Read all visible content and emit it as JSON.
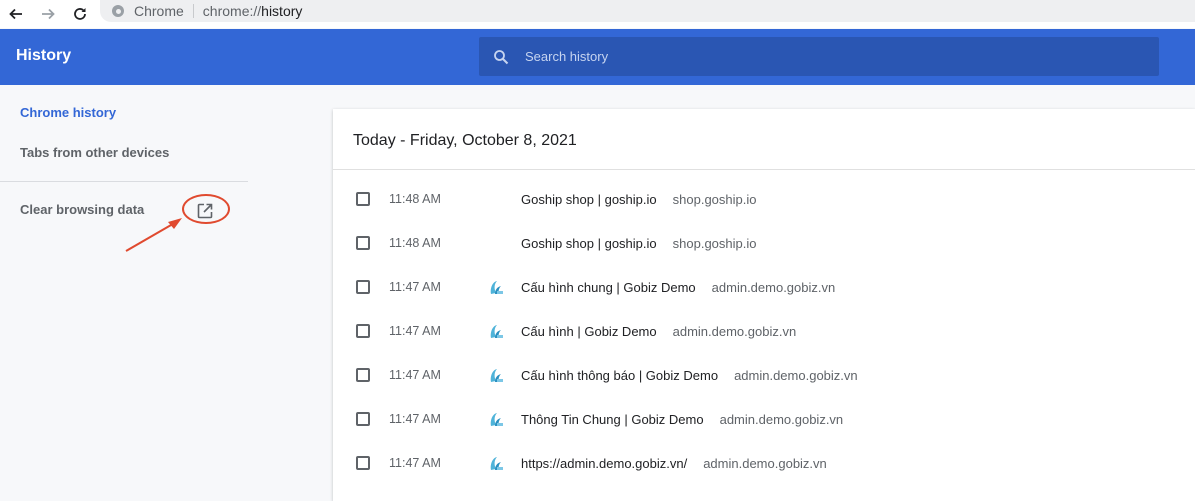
{
  "browser": {
    "chip_label": "Chrome",
    "url_scheme": "chrome://",
    "url_path": "history"
  },
  "header": {
    "title": "History",
    "search_placeholder": "Search history"
  },
  "sidebar": {
    "items": [
      {
        "label": "Chrome history"
      },
      {
        "label": "Tabs from other devices"
      },
      {
        "label": "Clear browsing data"
      }
    ]
  },
  "main": {
    "date_heading": "Today - Friday, October 8, 2021",
    "entries": [
      {
        "time": "11:48 AM",
        "title": "Goship shop | goship.io",
        "domain": "shop.goship.io",
        "favicon": "none"
      },
      {
        "time": "11:48 AM",
        "title": "Goship shop | goship.io",
        "domain": "shop.goship.io",
        "favicon": "none"
      },
      {
        "time": "11:47 AM",
        "title": "Cấu hình chung | Gobiz Demo",
        "domain": "admin.demo.gobiz.vn",
        "favicon": "gobiz-icon"
      },
      {
        "time": "11:47 AM",
        "title": "Cấu hình | Gobiz Demo",
        "domain": "admin.demo.gobiz.vn",
        "favicon": "gobiz-icon"
      },
      {
        "time": "11:47 AM",
        "title": "Cấu hình thông báo | Gobiz Demo",
        "domain": "admin.demo.gobiz.vn",
        "favicon": "gobiz-icon"
      },
      {
        "time": "11:47 AM",
        "title": "Thông Tin Chung | Gobiz Demo",
        "domain": "admin.demo.gobiz.vn",
        "favicon": "gobiz-icon"
      },
      {
        "time": "11:47 AM",
        "title": "https://admin.demo.gobiz.vn/",
        "domain": "admin.demo.gobiz.vn",
        "favicon": "gobiz-icon"
      }
    ]
  },
  "colors": {
    "header_blue": "#3367d6",
    "search_blue": "#2a56b3",
    "annotation_red": "#e04a2f"
  }
}
